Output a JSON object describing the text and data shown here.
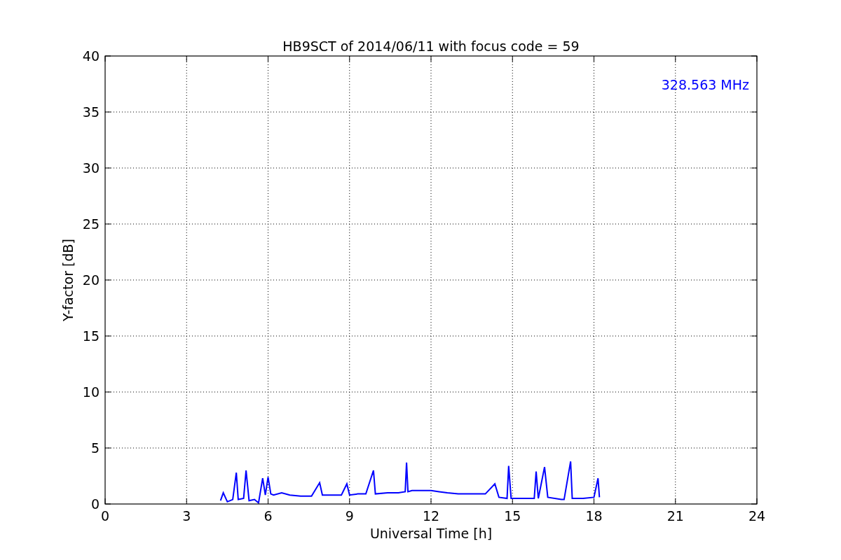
{
  "chart_data": {
    "type": "line",
    "title": "HB9SCT of 2014/06/11 with focus code = 59",
    "xlabel": "Universal Time [h]",
    "ylabel": "Y-factor [dB]",
    "x": [
      4.25,
      4.35,
      4.5,
      4.7,
      4.83,
      4.9,
      5.1,
      5.19,
      5.3,
      5.5,
      5.65,
      5.8,
      5.9,
      6.0,
      6.1,
      6.2,
      6.5,
      6.8,
      7.2,
      7.6,
      7.9,
      8.0,
      8.4,
      8.7,
      8.9,
      9.0,
      9.3,
      9.6,
      9.88,
      9.95,
      10.4,
      10.8,
      11.05,
      11.1,
      11.15,
      11.3,
      11.7,
      12.0,
      12.3,
      12.6,
      13.0,
      13.5,
      14.0,
      14.35,
      14.5,
      14.8,
      14.86,
      14.95,
      15.3,
      15.8,
      15.87,
      15.95,
      16.18,
      16.3,
      16.8,
      16.9,
      17.14,
      17.2,
      17.6,
      18.0,
      18.15,
      18.2
    ],
    "series": [
      {
        "name": "328.563 MHz",
        "color": "#0000ff",
        "values": [
          0.3,
          1.0,
          0.2,
          0.4,
          2.8,
          0.4,
          0.5,
          3.0,
          0.3,
          0.4,
          0.1,
          2.3,
          0.8,
          2.4,
          0.9,
          0.8,
          1.0,
          0.8,
          0.7,
          0.7,
          1.9,
          0.8,
          0.8,
          0.8,
          1.8,
          0.8,
          0.9,
          0.9,
          3.0,
          0.9,
          1.0,
          1.0,
          1.1,
          3.7,
          1.1,
          1.2,
          1.2,
          1.2,
          1.1,
          1.0,
          0.9,
          0.9,
          0.9,
          1.8,
          0.6,
          0.5,
          3.4,
          0.5,
          0.5,
          0.5,
          2.9,
          0.5,
          3.3,
          0.6,
          0.4,
          0.4,
          3.8,
          0.5,
          0.5,
          0.6,
          2.3,
          0.6
        ]
      }
    ],
    "xlim": [
      0,
      24
    ],
    "ylim": [
      0,
      40
    ],
    "xticks": [
      0,
      3,
      6,
      9,
      12,
      15,
      18,
      21,
      24
    ],
    "yticks": [
      0,
      5,
      10,
      15,
      20,
      25,
      30,
      35,
      40
    ],
    "grid": true
  }
}
